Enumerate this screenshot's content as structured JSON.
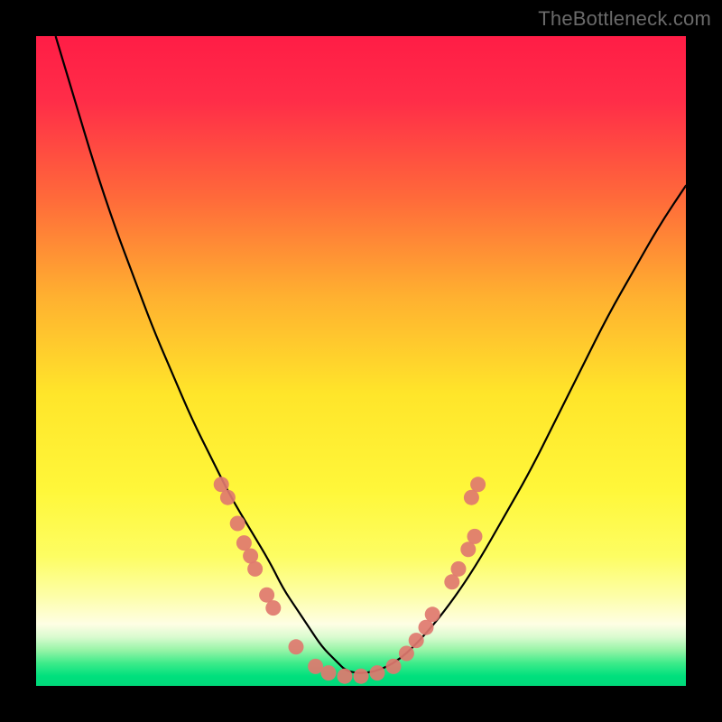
{
  "watermark": {
    "text": "TheBottleneck.com"
  },
  "colors": {
    "frame": "#000000",
    "curve": "#000000",
    "dot_fill": "#e0786f",
    "dot_stroke": "#c85a52",
    "gradient_stops": [
      {
        "offset": 0.0,
        "color": "#ff1d46"
      },
      {
        "offset": 0.1,
        "color": "#ff2d48"
      },
      {
        "offset": 0.25,
        "color": "#ff6a3a"
      },
      {
        "offset": 0.4,
        "color": "#ffb030"
      },
      {
        "offset": 0.55,
        "color": "#ffe52a"
      },
      {
        "offset": 0.7,
        "color": "#fff73a"
      },
      {
        "offset": 0.8,
        "color": "#fdfd62"
      },
      {
        "offset": 0.86,
        "color": "#fdfea6"
      },
      {
        "offset": 0.905,
        "color": "#fefee4"
      },
      {
        "offset": 0.925,
        "color": "#d9fbcf"
      },
      {
        "offset": 0.945,
        "color": "#97f4a7"
      },
      {
        "offset": 0.965,
        "color": "#3deb8a"
      },
      {
        "offset": 0.985,
        "color": "#00e07d"
      },
      {
        "offset": 1.0,
        "color": "#00d97a"
      }
    ]
  },
  "chart_data": {
    "type": "line",
    "title": "",
    "xlabel": "",
    "ylabel": "",
    "xlim": [
      0,
      100
    ],
    "ylim": [
      0,
      100
    ],
    "grid": false,
    "legend": false,
    "series": [
      {
        "name": "bottleneck-curve",
        "x": [
          3,
          6,
          9,
          12,
          15,
          18,
          21,
          24,
          27,
          30,
          33,
          36,
          38,
          40,
          42,
          44,
          46,
          48,
          52,
          56,
          60,
          64,
          68,
          72,
          76,
          80,
          84,
          88,
          92,
          96,
          100
        ],
        "y": [
          100,
          90,
          80,
          71,
          63,
          55,
          48,
          41,
          35,
          29,
          24,
          19,
          15,
          12,
          9,
          6,
          4,
          2,
          2,
          4,
          8,
          13,
          19,
          26,
          33,
          41,
          49,
          57,
          64,
          71,
          77
        ]
      }
    ],
    "dots": [
      {
        "x": 28.5,
        "y": 31
      },
      {
        "x": 29.5,
        "y": 29
      },
      {
        "x": 31.0,
        "y": 25
      },
      {
        "x": 32.0,
        "y": 22
      },
      {
        "x": 33.0,
        "y": 20
      },
      {
        "x": 33.7,
        "y": 18
      },
      {
        "x": 35.5,
        "y": 14
      },
      {
        "x": 36.5,
        "y": 12
      },
      {
        "x": 40.0,
        "y": 6
      },
      {
        "x": 43.0,
        "y": 3
      },
      {
        "x": 45.0,
        "y": 2
      },
      {
        "x": 47.5,
        "y": 1.5
      },
      {
        "x": 50.0,
        "y": 1.5
      },
      {
        "x": 52.5,
        "y": 2
      },
      {
        "x": 55.0,
        "y": 3
      },
      {
        "x": 57.0,
        "y": 5
      },
      {
        "x": 58.5,
        "y": 7
      },
      {
        "x": 60.0,
        "y": 9
      },
      {
        "x": 61.0,
        "y": 11
      },
      {
        "x": 64.0,
        "y": 16
      },
      {
        "x": 65.0,
        "y": 18
      },
      {
        "x": 66.5,
        "y": 21
      },
      {
        "x": 67.5,
        "y": 23
      },
      {
        "x": 67.0,
        "y": 29
      },
      {
        "x": 68.0,
        "y": 31
      }
    ]
  }
}
